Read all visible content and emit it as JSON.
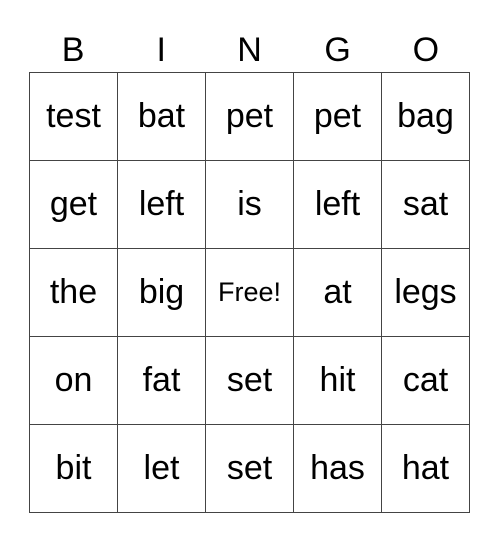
{
  "header": [
    "B",
    "I",
    "N",
    "G",
    "O"
  ],
  "rows": [
    [
      "test",
      "bat",
      "pet",
      "pet",
      "bag"
    ],
    [
      "get",
      "left",
      "is",
      "left",
      "sat"
    ],
    [
      "the",
      "big",
      "Free!",
      "at",
      "legs"
    ],
    [
      "on",
      "fat",
      "set",
      "hit",
      "cat"
    ],
    [
      "bit",
      "let",
      "set",
      "has",
      "hat"
    ]
  ]
}
